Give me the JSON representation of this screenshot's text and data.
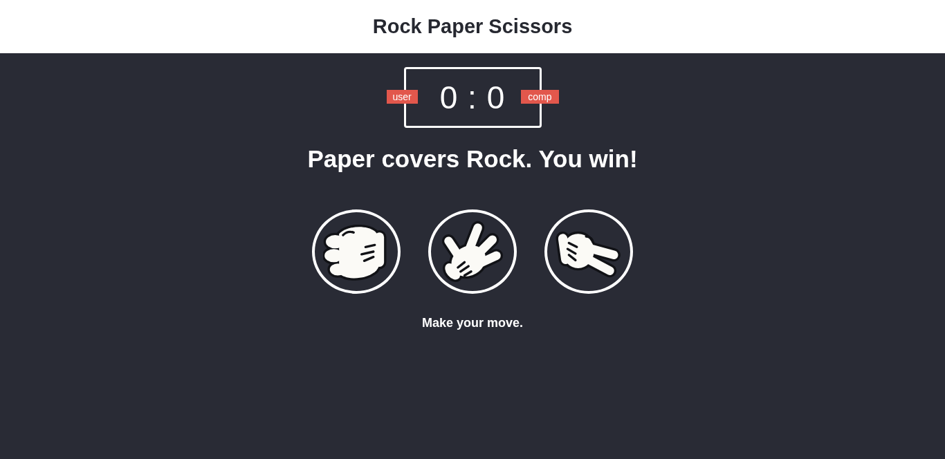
{
  "header": {
    "title": "Rock Paper Scissors"
  },
  "scoreboard": {
    "user_label": "user",
    "score": "0 : 0",
    "comp_label": "comp"
  },
  "result": "Paper covers Rock. You win!",
  "choices": [
    {
      "kind": "rock"
    },
    {
      "kind": "paper"
    },
    {
      "kind": "scissors"
    }
  ],
  "prompt": "Make your move."
}
